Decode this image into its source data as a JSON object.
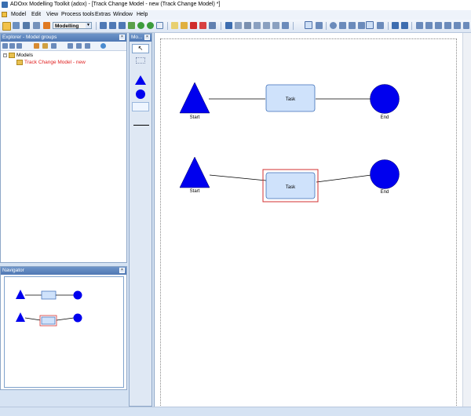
{
  "window": {
    "title": "ADOxx Modelling Toolkit (adox) - [Track Change Model - new (Track Change Model) *]"
  },
  "menubar": {
    "items": [
      "Model",
      "Edit",
      "View",
      "Process tools",
      "Extras",
      "Window",
      "Help"
    ]
  },
  "toolbar": {
    "mode": "Modelling"
  },
  "explorer": {
    "title": "Explorer - Model groups",
    "tree": {
      "root": "Models",
      "child": "Track Change Model - new"
    },
    "colors": {
      "child_text": "#e02020"
    }
  },
  "palette": {
    "title": "Mo..."
  },
  "navigator": {
    "title": "Navigator"
  },
  "diagram": {
    "row1": {
      "start_label": "Start",
      "task_label": "Task",
      "end_label": "End"
    },
    "row2": {
      "start_label": "Start",
      "task_label": "Task",
      "end_label": "End",
      "task_selected": true
    },
    "colors": {
      "shape_fill": "#0000ee",
      "task_fill": "#cfe2fb",
      "selection": "#d33030"
    }
  }
}
